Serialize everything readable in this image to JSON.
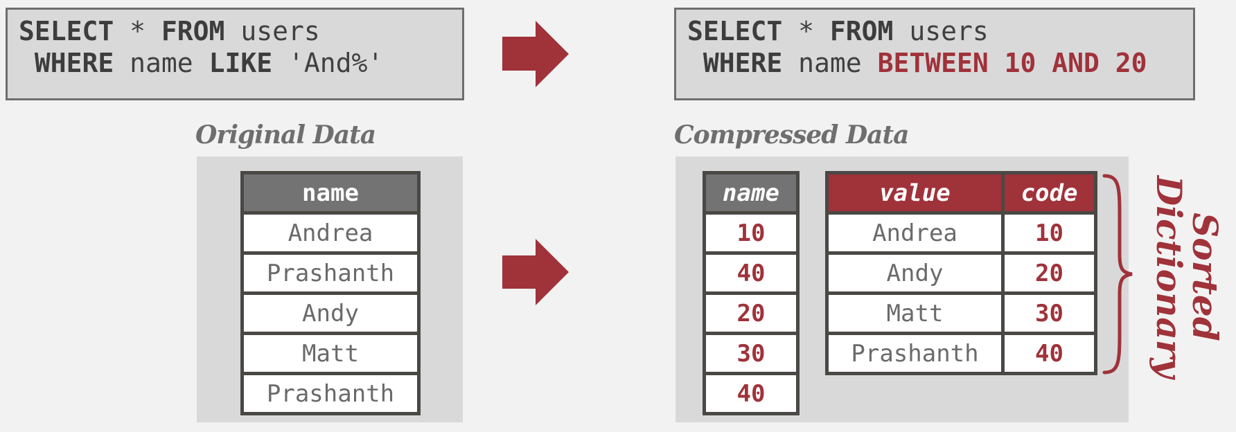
{
  "colors": {
    "accent": "#a0323a",
    "header_gray": "#737373",
    "panel_bg": "#d9d9d9",
    "text_gray": "#6a6a6a"
  },
  "query_original": {
    "line1": {
      "kw1": "SELECT",
      "star": " * ",
      "kw2": "FROM",
      "rest": " users"
    },
    "line2": {
      "indent": " ",
      "kw1": "WHERE",
      "mid": " name ",
      "kw2": "LIKE",
      "rest": " 'And%'"
    }
  },
  "query_compressed": {
    "line1": {
      "kw1": "SELECT",
      "star": " * ",
      "kw2": "FROM",
      "rest": " users"
    },
    "line2": {
      "indent": " ",
      "kw1": "WHERE",
      "mid": " name ",
      "highlight": "BETWEEN 10 AND 20"
    }
  },
  "original_data": {
    "title": "Original Data",
    "header": "name",
    "rows": [
      "Andrea",
      "Prashanth",
      "Andy",
      "Matt",
      "Prashanth"
    ]
  },
  "compressed_data": {
    "title": "Compressed Data",
    "encoded_column": {
      "header": "name",
      "rows": [
        "10",
        "40",
        "20",
        "30",
        "40"
      ]
    },
    "dictionary": {
      "headers": [
        "value",
        "code"
      ],
      "rows": [
        {
          "value": "Andrea",
          "code": "10"
        },
        {
          "value": "Andy",
          "code": "20"
        },
        {
          "value": "Matt",
          "code": "30"
        },
        {
          "value": "Prashanth",
          "code": "40"
        }
      ],
      "label_line1": "Sorted",
      "label_line2": "Dictionary"
    }
  },
  "icons": {
    "arrows": [
      "arrow-right-icon",
      "arrow-right-icon"
    ],
    "brace": "curly-brace-icon"
  }
}
